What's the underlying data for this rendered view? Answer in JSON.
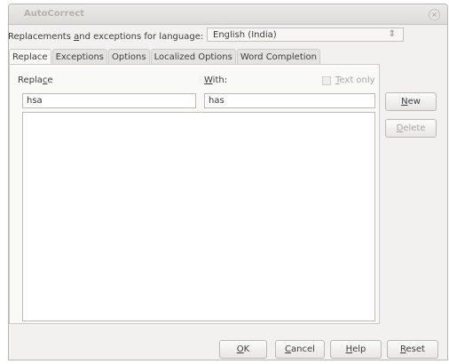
{
  "window": {
    "title": "AutoCorrect",
    "close_glyph": "×"
  },
  "language": {
    "label_pre": "Replacements ",
    "label_mnemonic": "a",
    "label_post": "nd exceptions for language:",
    "selected": "English (India)",
    "arrow": "⇕"
  },
  "tabs": [
    {
      "label": "Replace",
      "active": true
    },
    {
      "label": "Exceptions"
    },
    {
      "label": "Options"
    },
    {
      "label": "Localized Options"
    },
    {
      "label": "Word Completion"
    }
  ],
  "replace": {
    "replace_label_pre": "Repla",
    "replace_label_mnemonic": "c",
    "replace_label_post": "e",
    "with_label_mnemonic": "W",
    "with_label_post": "ith:",
    "text_only_mnemonic": "T",
    "text_only_post": "ext only",
    "text_only_checked": false,
    "replace_value": "hsa",
    "with_value": "has"
  },
  "side_buttons": {
    "new_mnemonic": "N",
    "new_post": "ew",
    "delete_mnemonic": "D",
    "delete_post": "elete"
  },
  "footer": {
    "ok_mnemonic": "O",
    "ok_post": "K",
    "cancel_mnemonic": "C",
    "cancel_post": "ancel",
    "help_mnemonic": "H",
    "help_post": "elp",
    "reset_mnemonic": "R",
    "reset_post": "eset"
  }
}
